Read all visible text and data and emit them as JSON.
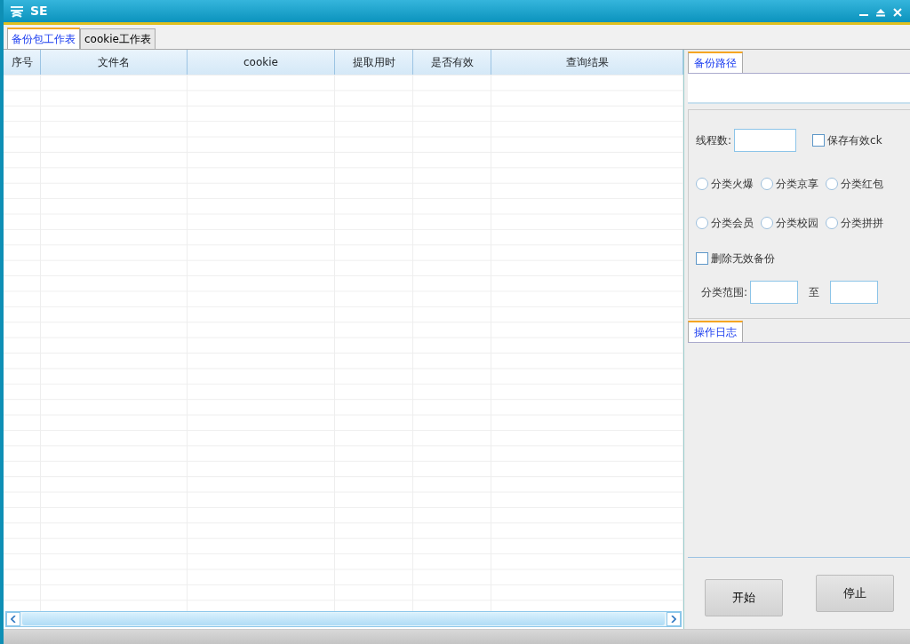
{
  "window": {
    "title": "SE"
  },
  "tabs": [
    {
      "label": "备份包工作表",
      "selected": true
    },
    {
      "label": "cookie工作表",
      "selected": false
    }
  ],
  "table": {
    "columns": [
      "序号",
      "文件名",
      "cookie",
      "提取用时",
      "是否有效",
      "查询结果"
    ]
  },
  "path_panel": {
    "tab": {
      "label": "备份路径",
      "selected": true
    }
  },
  "settings": {
    "threads_label": "线程数:",
    "save_valid": {
      "label": "保存有效ck",
      "checked": false
    },
    "categories": [
      {
        "label": "分类火爆",
        "selected": false
      },
      {
        "label": "分类京享",
        "selected": false
      },
      {
        "label": "分类红包",
        "selected": false
      },
      {
        "label": "分类会员",
        "selected": false
      },
      {
        "label": "分类校园",
        "selected": false
      },
      {
        "label": "分类拼拼",
        "selected": false
      }
    ],
    "delete_invalid": {
      "label": "删除无效备份",
      "checked": false
    },
    "range_label": "分类范围:",
    "range_to": "至"
  },
  "log_panel": {
    "tab": {
      "label": "操作日志",
      "selected": true
    }
  },
  "buttons": [
    "开始",
    "停止"
  ]
}
